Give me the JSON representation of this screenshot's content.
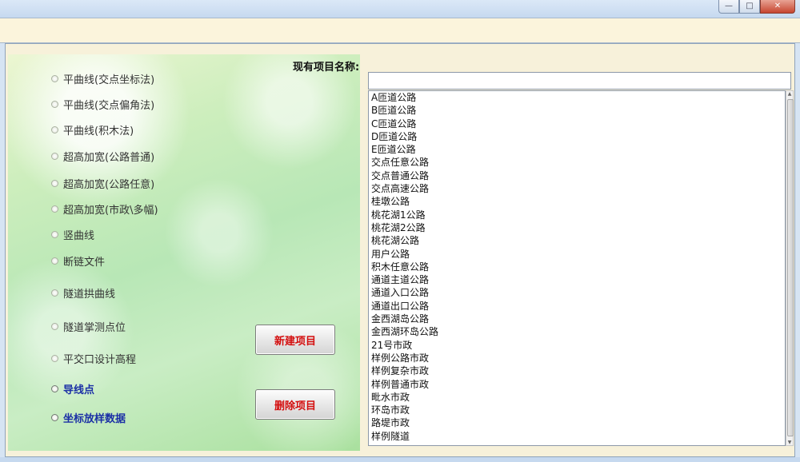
{
  "window": {
    "min_label": "—",
    "max_label": "□",
    "close_label": "✕"
  },
  "options": [
    {
      "label": "平曲线(交点坐标法)",
      "style": "normal"
    },
    {
      "label": "平曲线(交点偏角法)",
      "style": "normal"
    },
    {
      "label": "平曲线(积木法)",
      "style": "normal"
    },
    {
      "label": "超高加宽(公路普通)",
      "style": "normal"
    },
    {
      "label": "超高加宽(公路任意)",
      "style": "normal"
    },
    {
      "label": "超高加宽(市政\\多幅)",
      "style": "normal"
    },
    {
      "label": "竖曲线",
      "style": "normal"
    },
    {
      "label": "断链文件",
      "style": "normal"
    },
    {
      "label": "隧道拱曲线",
      "style": "normal"
    },
    {
      "label": "隧道掌测点位",
      "style": "normal"
    },
    {
      "label": "平交口设计高程",
      "style": "normal"
    },
    {
      "label": "导线点",
      "style": "blue"
    },
    {
      "label": "坐标放样数据",
      "style": "blue"
    }
  ],
  "buttons": {
    "new_project": "新建项目",
    "delete_project": "删除项目"
  },
  "project": {
    "label": "现有项目名称:",
    "value": "",
    "items": [
      "A匝道公路",
      "B匝道公路",
      "C匝道公路",
      "D匝道公路",
      "E匝道公路",
      "交点任意公路",
      "交点普通公路",
      "交点高速公路",
      "桂墩公路",
      "桃花湖1公路",
      "桃花湖2公路",
      "桃花湖公路",
      "用户公路",
      "积木任意公路",
      "通道主道公路",
      "通道入口公路",
      "通道出口公路",
      "金西湖岛公路",
      "金西湖环岛公路",
      "21号市政",
      "样例公路市政",
      "样例复杂市政",
      "样例普通市政",
      "毗水市政",
      "环岛市政",
      "路堤市政",
      "样例隧道"
    ]
  },
  "colors": {
    "button_text": "#d40e0e",
    "blue_option": "#1a2fa6",
    "top_strip": "#fbf4dc"
  }
}
